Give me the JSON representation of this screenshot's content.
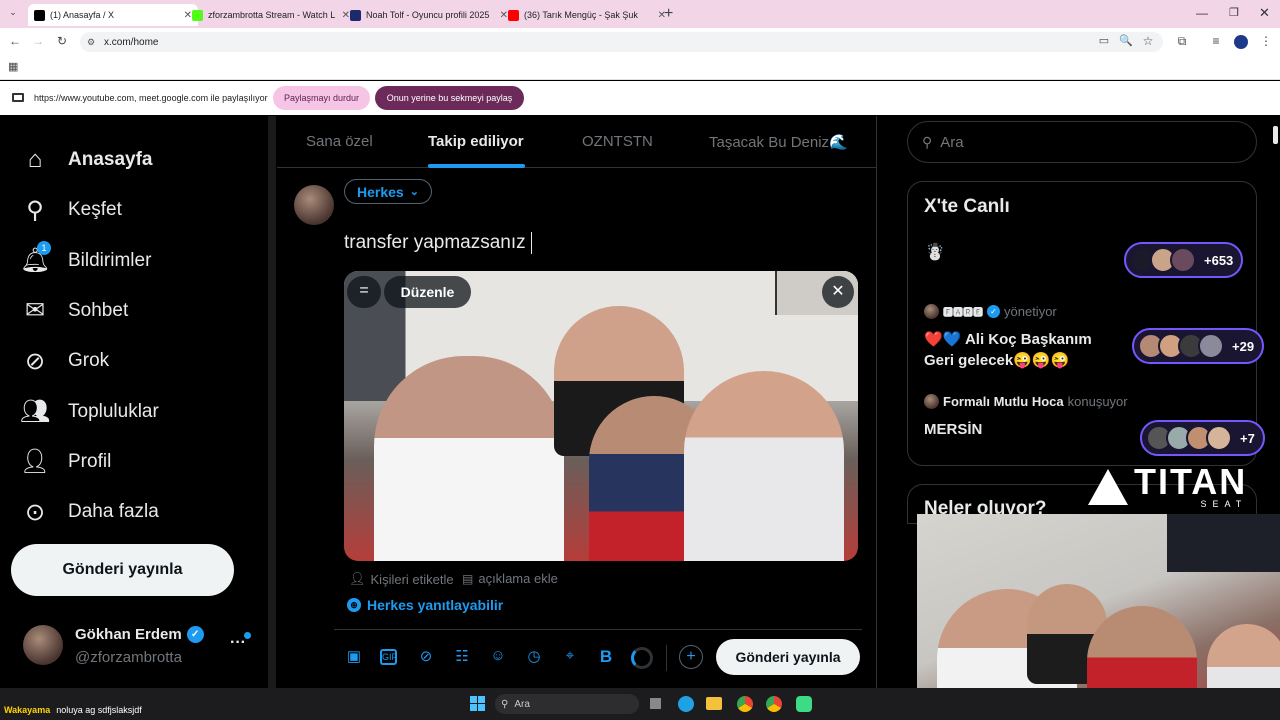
{
  "browser": {
    "tabs": [
      {
        "label": "(1) Anasayfa / X",
        "favicon_color": "#000000",
        "active": true
      },
      {
        "label": "zforzambrotta Stream - Watch L",
        "favicon_color": "#53fc18",
        "active": false
      },
      {
        "label": "Noah Tolf - Oyuncu profili 2025",
        "favicon_color": "#1a2a6c",
        "active": false
      },
      {
        "label": "(36) Tarık Mengüç - Şak Şuk",
        "favicon_color": "#ff0000",
        "active": false
      }
    ],
    "new_tab": "+",
    "url": "x.com/home",
    "share_notice": "https://www.youtube.com, meet.google.com ile paylaşılıyor",
    "stop_sharing_label": "Paylaşmayı durdur",
    "share_this_tab_label": "Onun yerine bu sekmeyi paylaş"
  },
  "nav": {
    "items": [
      {
        "label": "Anasayfa",
        "icon": "home-icon",
        "bold": true
      },
      {
        "label": "Keşfet",
        "icon": "search-icon"
      },
      {
        "label": "Bildirimler",
        "icon": "bell-icon",
        "badge": "1"
      },
      {
        "label": "Sohbet",
        "icon": "mail-icon"
      },
      {
        "label": "Grok",
        "icon": "grok-icon"
      },
      {
        "label": "Topluluklar",
        "icon": "people-icon"
      },
      {
        "label": "Profil",
        "icon": "person-icon"
      },
      {
        "label": "Daha fazla",
        "icon": "more-circle-icon"
      }
    ],
    "post_button": "Gönderi yayınla",
    "account": {
      "name": "Gökhan Erdem",
      "handle": "@zforzambrotta"
    }
  },
  "timeline_tabs": [
    "Sana özel",
    "Takip ediliyor",
    "OZNTSTN",
    "Taşacak Bu Deniz🌊"
  ],
  "active_tab": "Takip ediliyor",
  "composer": {
    "audience": "Herkes",
    "text": "transfer yapmazsanız",
    "edit_label": "Düzenle",
    "tag_people": "Kişileri etiketle",
    "add_description": "açıklama ekle",
    "reply_setting": "Herkes yanıtlayabilir",
    "post_label": "Gönderi yayınla"
  },
  "right": {
    "search_placeholder": "Ara",
    "live_title": "X'te Canlı",
    "spaces": [
      {
        "host": "",
        "role": "",
        "title": "",
        "count": "+653",
        "emoji": "☃️"
      },
      {
        "host": "🅵🅰🆁🅴",
        "role": "yönetiyor",
        "title": "❤️💙 Ali Koç Başkanım Geri gelecek😜😜😜",
        "count": "+29"
      },
      {
        "host": "Formalı Mutlu Hoca",
        "role": "konuşuyor",
        "title": "MERSİN",
        "count": "+7"
      }
    ],
    "whats_happening": "Neler oluyor?"
  },
  "overlay": {
    "brand": "TITAN",
    "brand_sub": "SEAT",
    "chat_user": "Wakayama",
    "chat_text": "noluya ag sdfjslaksjdf"
  },
  "taskbar": {
    "search": "Ara"
  },
  "colors": {
    "accent": "#1d9bf0",
    "share_pink": "#f6c5e6",
    "share_purple": "#6b2a5a",
    "verified": "#1d9bf0"
  }
}
